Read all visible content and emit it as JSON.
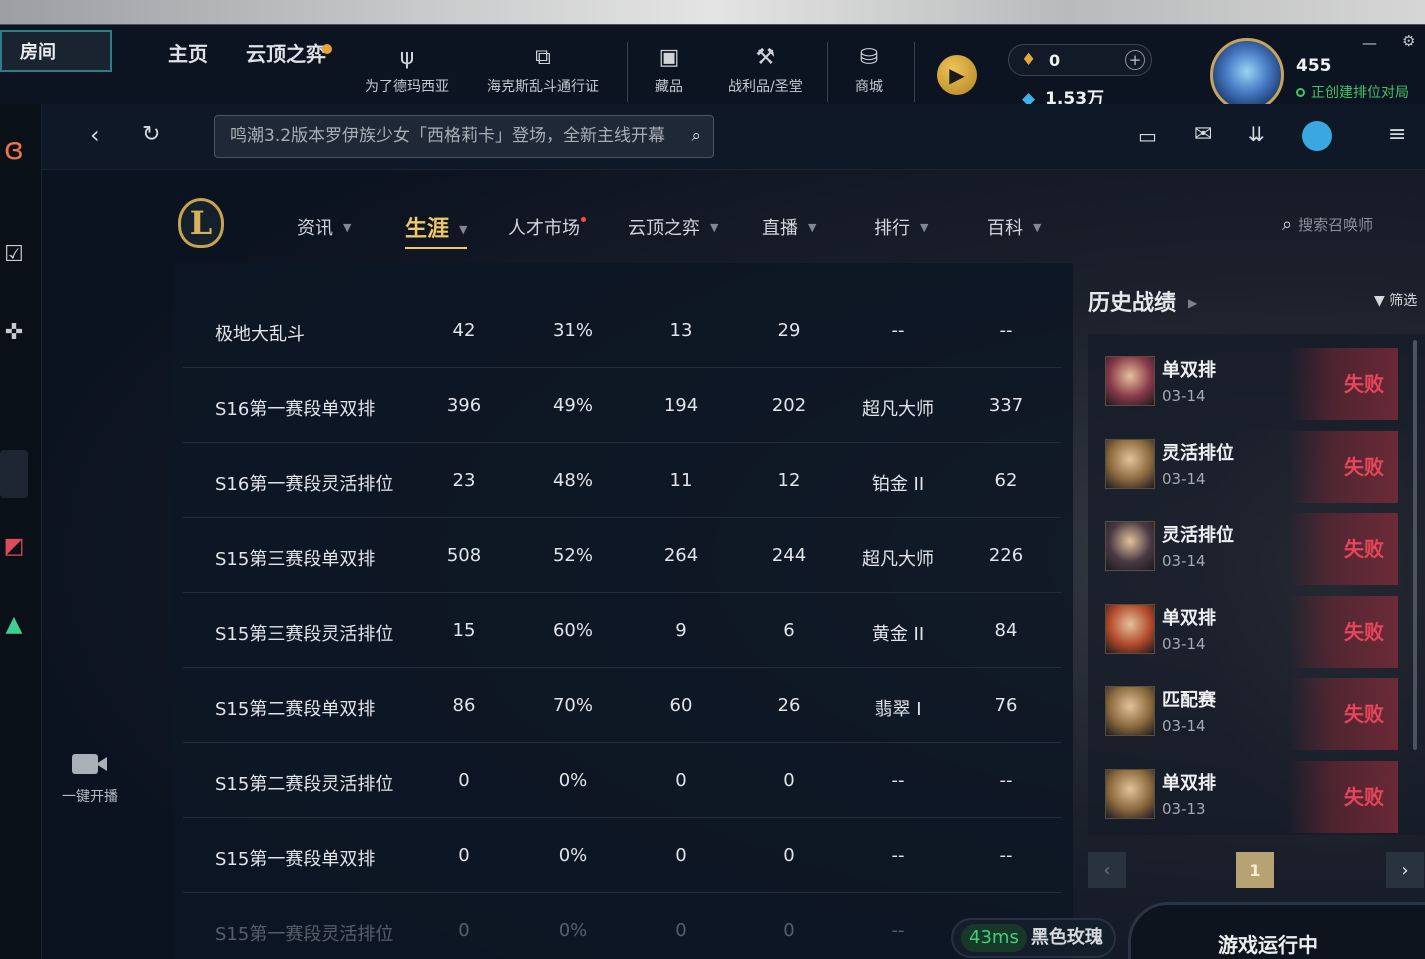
{
  "topbar": {
    "room_label": "房间",
    "nav_main": [
      "主页",
      "云顶之弈"
    ],
    "nav_icons": [
      {
        "label": "为了德玛西亚",
        "icon": "trident-icon"
      },
      {
        "label": "海克斯乱斗通行证",
        "icon": "pass-icon"
      },
      {
        "label": "藏品",
        "icon": "collection-icon"
      },
      {
        "label": "战利品/圣堂",
        "icon": "loot-icon"
      },
      {
        "label": "商城",
        "icon": "store-coins-icon"
      }
    ],
    "rp_value": "0",
    "be_value": "1.53万",
    "level": "455",
    "status": "正创建排位对局",
    "colors": {
      "accent_gold": "#f0c86a",
      "status_green": "#42c26b",
      "defeat_red": "#e8455a"
    }
  },
  "bar2": {
    "search_text": "鸣潮3.2版本罗伊族少女「西格莉卡」登场，全新主线开幕"
  },
  "nav": {
    "tabs": [
      "资讯",
      "生涯",
      "人才市场",
      "云顶之弈",
      "直播",
      "排行",
      "百科"
    ],
    "active_tab": "生涯",
    "summoner_search_placeholder": "搜索召唤师"
  },
  "left": {
    "video_label": "一键开播"
  },
  "table": {
    "rows": [
      {
        "name": "极地大乱斗",
        "games": "42",
        "winrate": "31%",
        "wins": "13",
        "losses": "29",
        "rank": "--",
        "points": "--"
      },
      {
        "name": "S16第一赛段单双排",
        "games": "396",
        "winrate": "49%",
        "wins": "194",
        "losses": "202",
        "rank": "超凡大师",
        "points": "337"
      },
      {
        "name": "S16第一赛段灵活排位",
        "games": "23",
        "winrate": "48%",
        "wins": "11",
        "losses": "12",
        "rank": "铂金 II",
        "points": "62"
      },
      {
        "name": "S15第三赛段单双排",
        "games": "508",
        "winrate": "52%",
        "wins": "264",
        "losses": "244",
        "rank": "超凡大师",
        "points": "226"
      },
      {
        "name": "S15第三赛段灵活排位",
        "games": "15",
        "winrate": "60%",
        "wins": "9",
        "losses": "6",
        "rank": "黄金 II",
        "points": "84"
      },
      {
        "name": "S15第二赛段单双排",
        "games": "86",
        "winrate": "70%",
        "wins": "60",
        "losses": "26",
        "rank": "翡翠 I",
        "points": "76"
      },
      {
        "name": "S15第二赛段灵活排位",
        "games": "0",
        "winrate": "0%",
        "wins": "0",
        "losses": "0",
        "rank": "--",
        "points": "--"
      },
      {
        "name": "S15第一赛段单双排",
        "games": "0",
        "winrate": "0%",
        "wins": "0",
        "losses": "0",
        "rank": "--",
        "points": "--"
      },
      {
        "name": "S15第一赛段灵活排位",
        "games": "0",
        "winrate": "0%",
        "wins": "0",
        "losses": "0",
        "rank": "--",
        "points": "--"
      }
    ]
  },
  "history": {
    "title": "历史战绩",
    "filter_label": "筛选",
    "matches": [
      {
        "mode": "单双排",
        "date": "03-14",
        "result": "失败",
        "champ_color": "#8a3a4a"
      },
      {
        "mode": "灵活排位",
        "date": "03-14",
        "result": "失败",
        "champ_color": "#8c6a3e"
      },
      {
        "mode": "灵活排位",
        "date": "03-14",
        "result": "失败",
        "champ_color": "#4a3a44"
      },
      {
        "mode": "单双排",
        "date": "03-14",
        "result": "失败",
        "champ_color": "#b34a2a"
      },
      {
        "mode": "匹配赛",
        "date": "03-14",
        "result": "失败",
        "champ_color": "#8c6a3e"
      },
      {
        "mode": "单双排",
        "date": "03-13",
        "result": "失败",
        "champ_color": "#8c6a3e"
      }
    ],
    "page": "1"
  },
  "bottom": {
    "ping": "43ms",
    "server": "黑色玫瑰",
    "game_status": "游戏运行中"
  }
}
